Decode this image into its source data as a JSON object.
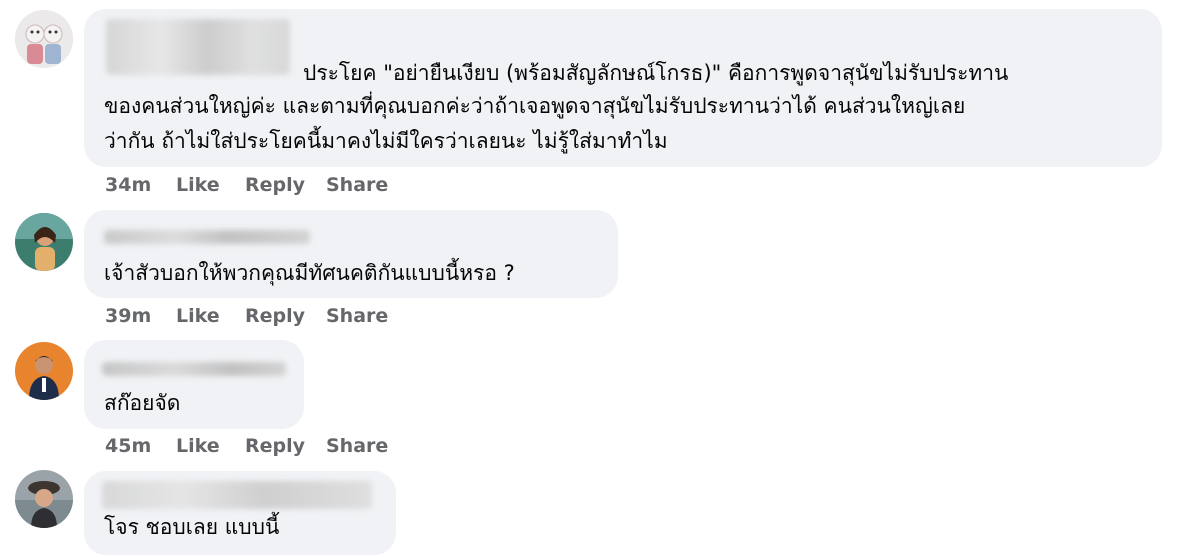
{
  "comments": [
    {
      "text_lines": [
        "ประโยค \"อย่ายืนเงียบ (พร้อมสัญลักษณ์โกรธ)\" คือการพูดจาสุนัขไม่รับประทาน",
        "ของคนส่วนใหญ่ค่ะ และตามที่คุณบอกค่ะว่าถ้าเจอพูดจาสุนัขไม่รับประทานว่าได้ คนส่วนใหญ่เลย",
        "ว่ากัน ถ้าไม่ใส่ประโยคนี้มาคงไม่มีใครว่าเลยนะ ไม่รู้ใส่มาทำไม"
      ],
      "time": "34m",
      "like": "Like",
      "reply": "Reply",
      "share": "Share"
    },
    {
      "text_lines": [
        "เจ้าสัวบอกให้พวกคุณมีทัศนคติกันแบบนี้หรอ ?"
      ],
      "time": "39m",
      "like": "Like",
      "reply": "Reply",
      "share": "Share"
    },
    {
      "text_lines": [
        "สก๊อยจัด"
      ],
      "time": "45m",
      "like": "Like",
      "reply": "Reply",
      "share": "Share"
    },
    {
      "text_lines": [
        "โจร ชอบเลย แบบนี้"
      ]
    }
  ],
  "colors": {
    "bubble": "#f0f2f5",
    "text": "#050505",
    "meta": "#65676b"
  }
}
